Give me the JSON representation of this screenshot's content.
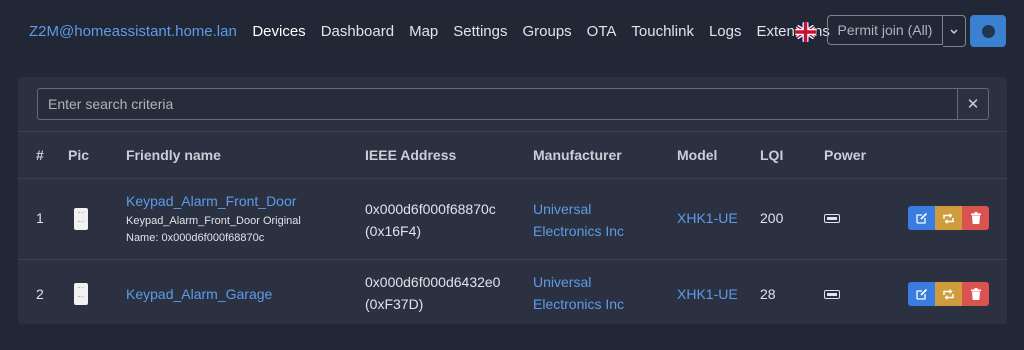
{
  "nav": {
    "brand": "Z2M@homeassistant.home.lan",
    "links": [
      "Devices",
      "Dashboard",
      "Map",
      "Settings",
      "Groups",
      "OTA",
      "Touchlink",
      "Logs",
      "Extensions"
    ],
    "permit_join_label": "Permit join (All)"
  },
  "search": {
    "placeholder": "Enter search criteria",
    "clear_symbol": "✕"
  },
  "table": {
    "headers": [
      "#",
      "Pic",
      "Friendly name",
      "IEEE Address",
      "Manufacturer",
      "Model",
      "LQI",
      "Power"
    ],
    "rows": [
      {
        "num": "1",
        "friendly_name": "Keypad_Alarm_Front_Door",
        "description_line1": "Keypad_Alarm_Front_Door Original",
        "description_line2": "Name: 0x000d6f000f68870c",
        "ieee": "0x000d6f000f68870c",
        "nwk": "(0x16F4)",
        "manufacturer_line1": "Universal",
        "manufacturer_line2": "Electronics Inc",
        "model": "XHK1-UE",
        "lqi": "200"
      },
      {
        "num": "2",
        "friendly_name": "Keypad_Alarm_Garage",
        "ieee": "0x000d6f000d6432e0",
        "nwk": "(0xF37D)",
        "manufacturer_line1": "Universal",
        "manufacturer_line2": "Electronics Inc",
        "model": "XHK1-UE",
        "lqi": "28"
      }
    ]
  },
  "colors": {
    "background": "#222736",
    "card": "#2b3140",
    "link": "#5e9be8",
    "edit": "#3a7de0",
    "swap": "#d09b3c",
    "delete": "#d9534f"
  }
}
